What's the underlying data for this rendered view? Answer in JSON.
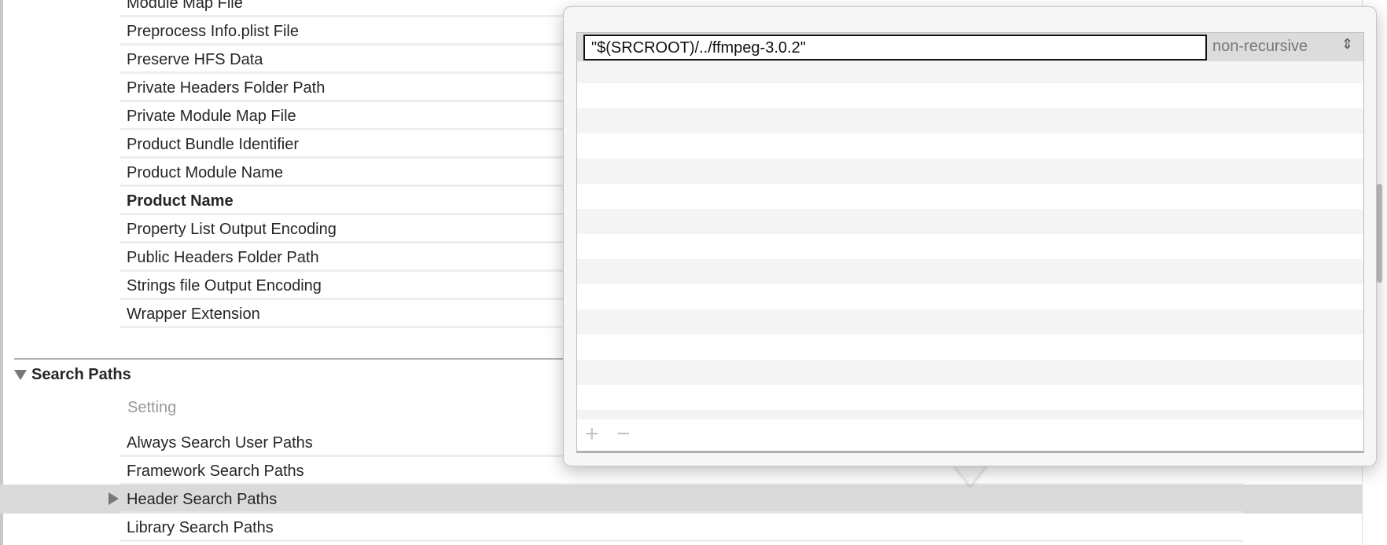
{
  "settings_rows": [
    "Module Map File",
    "Preprocess Info.plist File",
    "Preserve HFS Data",
    "Private Headers Folder Path",
    "Private Module Map File",
    "Product Bundle Identifier",
    "Product Module Name",
    "Product Name",
    "Property List Output Encoding",
    "Public Headers Folder Path",
    "Strings file Output Encoding",
    "Wrapper Extension"
  ],
  "search_paths": {
    "title": "Search Paths",
    "column_header": "Setting",
    "rows": [
      "Always Search User Paths",
      "Framework Search Paths",
      "Header Search Paths",
      "Library Search Paths"
    ],
    "selected": "Header Search Paths"
  },
  "popover": {
    "path_value": "\"$(SRCROOT)/../ffmpeg-3.0.2\"",
    "recursion": "non-recursive",
    "add_label": "+",
    "remove_label": "−"
  }
}
